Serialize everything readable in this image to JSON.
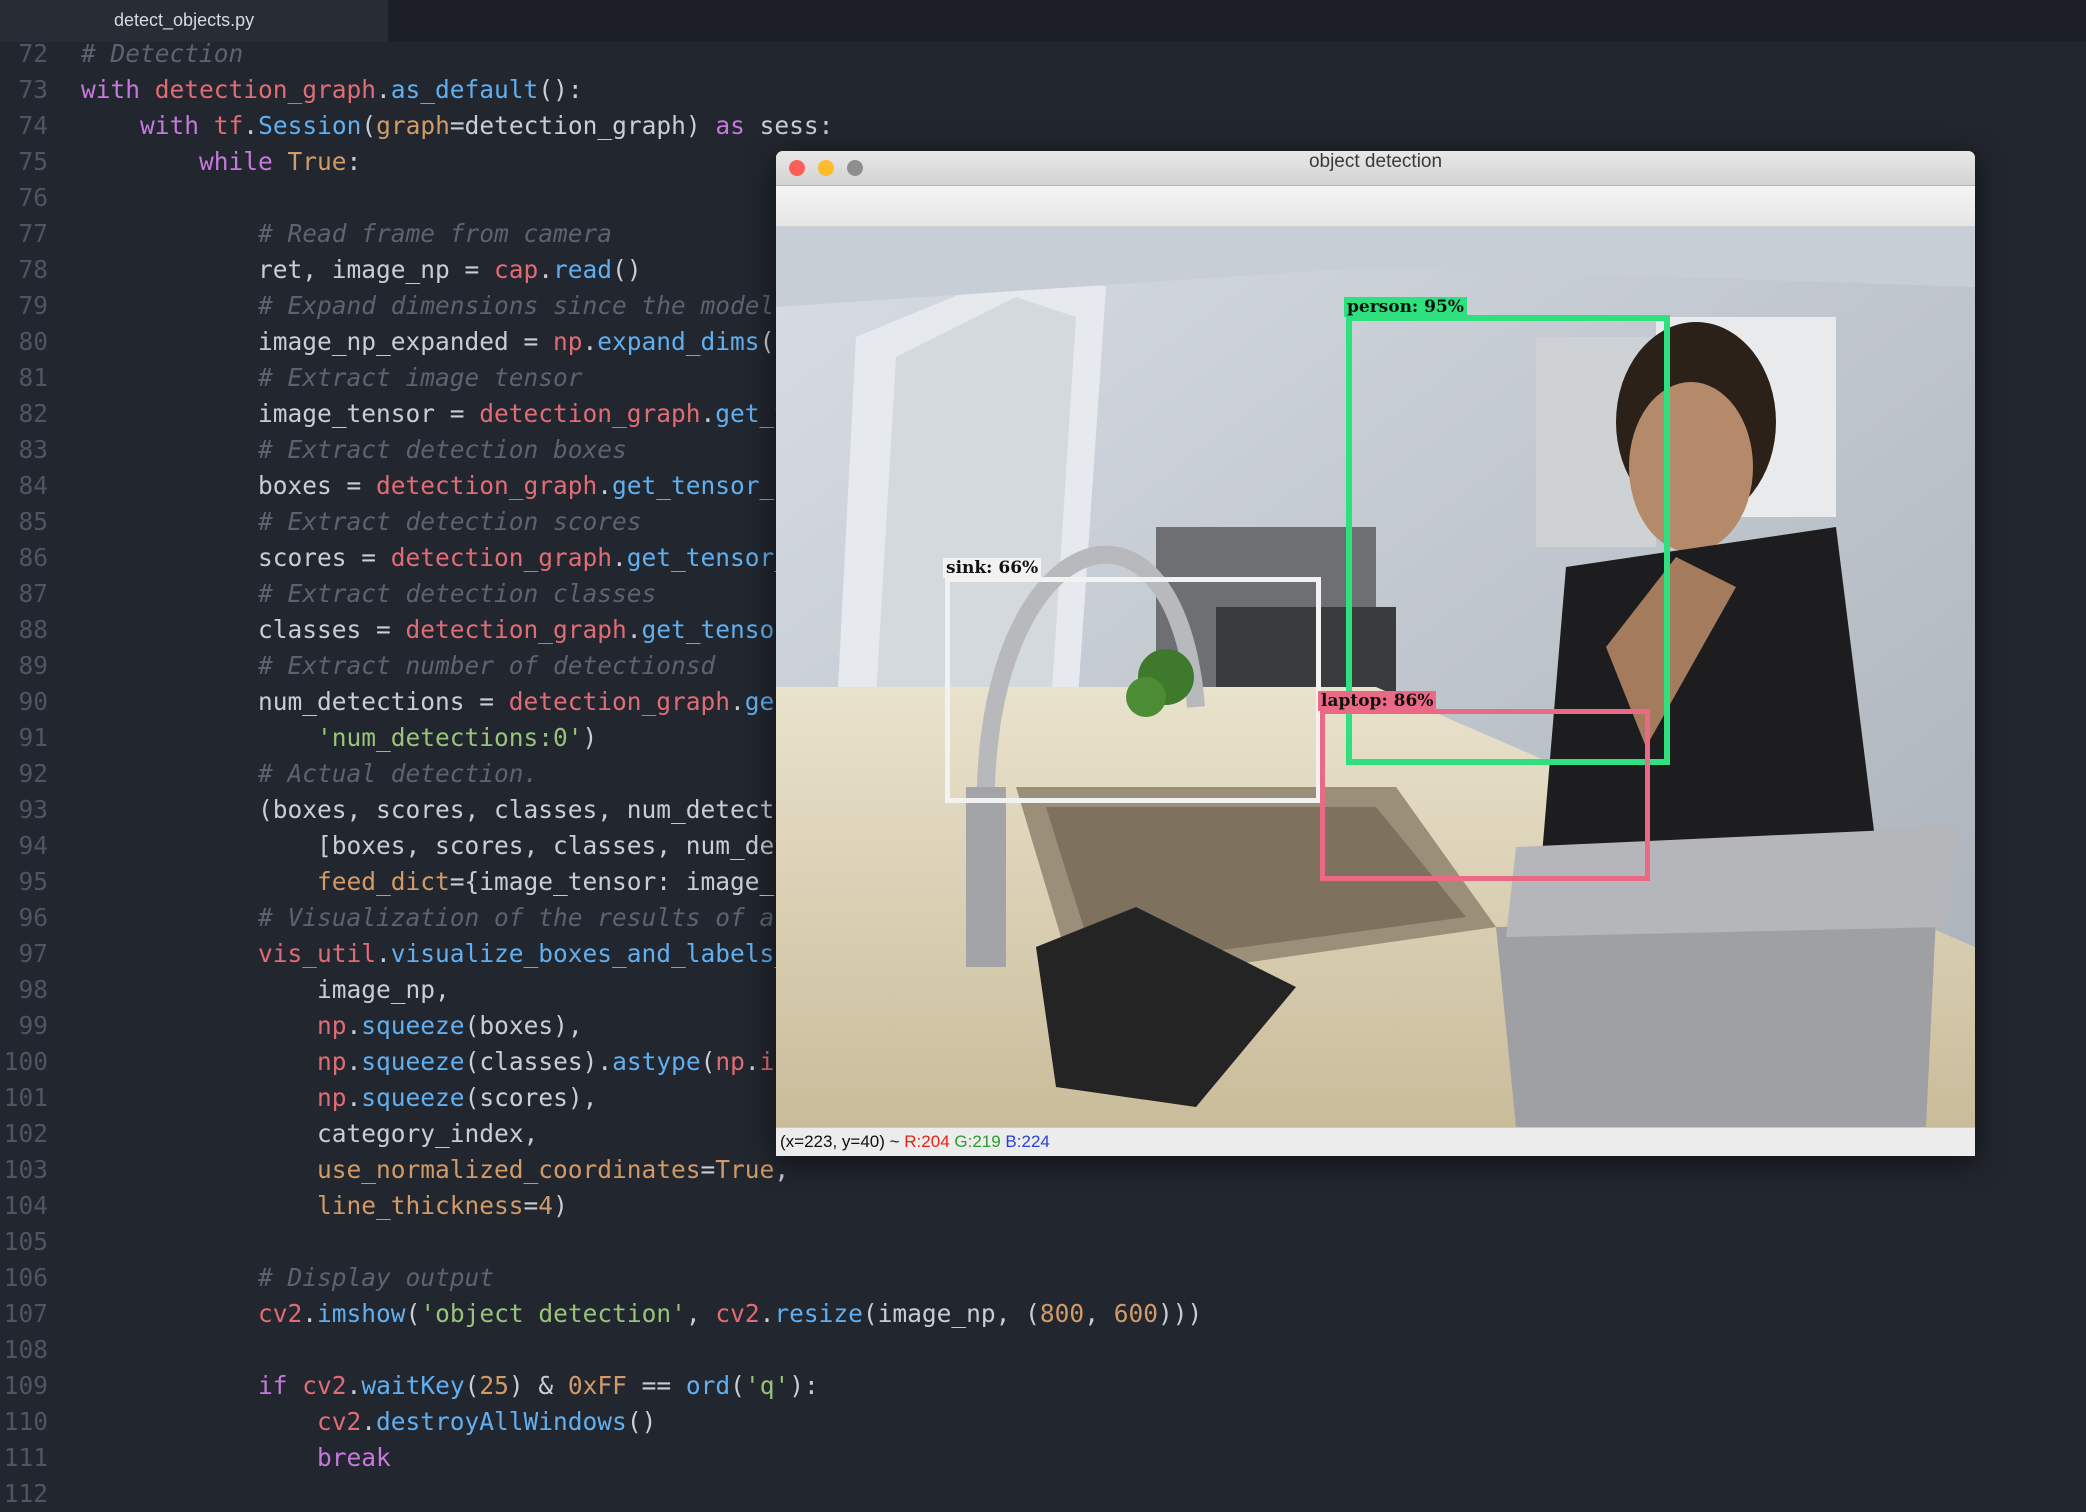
{
  "editor": {
    "tab_label": "detect_objects.py",
    "lines": [
      {
        "n": "72",
        "t": [
          [
            "cm",
            "# Detection"
          ]
        ]
      },
      {
        "n": "73",
        "t": [
          [
            "kw",
            "with "
          ],
          [
            "var",
            "detection_graph"
          ],
          [
            "p",
            "."
          ],
          [
            "fn",
            "as_default"
          ],
          [
            "p",
            "():"
          ]
        ]
      },
      {
        "n": "74",
        "t": [
          [
            "p",
            "    "
          ],
          [
            "kw",
            "with "
          ],
          [
            "var",
            "tf"
          ],
          [
            "p",
            "."
          ],
          [
            "fn",
            "Session"
          ],
          [
            "p",
            "("
          ],
          [
            "prm",
            "graph"
          ],
          [
            "p",
            "=detection_graph) "
          ],
          [
            "kw",
            "as"
          ],
          [
            "p",
            " sess:"
          ]
        ]
      },
      {
        "n": "75",
        "t": [
          [
            "p",
            "        "
          ],
          [
            "kw",
            "while "
          ],
          [
            "num",
            "True"
          ],
          [
            "p",
            ":"
          ]
        ]
      },
      {
        "n": "76",
        "t": []
      },
      {
        "n": "77",
        "t": [
          [
            "p",
            "            "
          ],
          [
            "cm",
            "# Read frame from camera"
          ]
        ]
      },
      {
        "n": "78",
        "t": [
          [
            "p",
            "            ret, image_np = "
          ],
          [
            "var",
            "cap"
          ],
          [
            "p",
            "."
          ],
          [
            "fn",
            "read"
          ],
          [
            "p",
            "()"
          ]
        ]
      },
      {
        "n": "79",
        "t": [
          [
            "p",
            "            "
          ],
          [
            "cm",
            "# Expand dimensions since the model"
          ]
        ]
      },
      {
        "n": "80",
        "t": [
          [
            "p",
            "            image_np_expanded = "
          ],
          [
            "var",
            "np"
          ],
          [
            "p",
            "."
          ],
          [
            "fn",
            "expand_dims"
          ],
          [
            "p",
            "(i"
          ]
        ]
      },
      {
        "n": "81",
        "t": [
          [
            "p",
            "            "
          ],
          [
            "cm",
            "# Extract image tensor"
          ]
        ]
      },
      {
        "n": "82",
        "t": [
          [
            "p",
            "            image_tensor = "
          ],
          [
            "var",
            "detection_graph"
          ],
          [
            "p",
            "."
          ],
          [
            "fn",
            "get_t"
          ]
        ]
      },
      {
        "n": "83",
        "t": [
          [
            "p",
            "            "
          ],
          [
            "cm",
            "# Extract detection boxes"
          ]
        ]
      },
      {
        "n": "84",
        "t": [
          [
            "p",
            "            boxes = "
          ],
          [
            "var",
            "detection_graph"
          ],
          [
            "p",
            "."
          ],
          [
            "fn",
            "get_tensor_b"
          ]
        ]
      },
      {
        "n": "85",
        "t": [
          [
            "p",
            "            "
          ],
          [
            "cm",
            "# Extract detection scores"
          ]
        ]
      },
      {
        "n": "86",
        "t": [
          [
            "p",
            "            scores = "
          ],
          [
            "var",
            "detection_graph"
          ],
          [
            "p",
            "."
          ],
          [
            "fn",
            "get_tensor_"
          ]
        ]
      },
      {
        "n": "87",
        "t": [
          [
            "p",
            "            "
          ],
          [
            "cm",
            "# Extract detection classes"
          ]
        ]
      },
      {
        "n": "88",
        "t": [
          [
            "p",
            "            classes = "
          ],
          [
            "var",
            "detection_graph"
          ],
          [
            "p",
            "."
          ],
          [
            "fn",
            "get_tensor"
          ]
        ]
      },
      {
        "n": "89",
        "t": [
          [
            "p",
            "            "
          ],
          [
            "cm",
            "# Extract number of detectionsd"
          ]
        ]
      },
      {
        "n": "90",
        "t": [
          [
            "p",
            "            num_detections = "
          ],
          [
            "var",
            "detection_graph"
          ],
          [
            "p",
            "."
          ],
          [
            "fn",
            "get"
          ]
        ]
      },
      {
        "n": "91",
        "t": [
          [
            "p",
            "                "
          ],
          [
            "str",
            "'num_detections:0'"
          ],
          [
            "p",
            ")"
          ]
        ]
      },
      {
        "n": "92",
        "t": [
          [
            "p",
            "            "
          ],
          [
            "cm",
            "# Actual detection."
          ]
        ]
      },
      {
        "n": "93",
        "t": [
          [
            "p",
            "            (boxes, scores, classes, num_detecti"
          ]
        ]
      },
      {
        "n": "94",
        "t": [
          [
            "p",
            "                [boxes, scores, classes, num_det"
          ]
        ]
      },
      {
        "n": "95",
        "t": [
          [
            "p",
            "                "
          ],
          [
            "prm",
            "feed_dict"
          ],
          [
            "p",
            "={image_tensor: image_n"
          ]
        ]
      },
      {
        "n": "96",
        "t": [
          [
            "p",
            "            "
          ],
          [
            "cm",
            "# Visualization of the results of a"
          ]
        ]
      },
      {
        "n": "97",
        "t": [
          [
            "p",
            "            "
          ],
          [
            "var",
            "vis_util"
          ],
          [
            "p",
            "."
          ],
          [
            "fn",
            "visualize_boxes_and_labels_"
          ]
        ]
      },
      {
        "n": "98",
        "t": [
          [
            "p",
            "                image_np,"
          ]
        ]
      },
      {
        "n": "99",
        "t": [
          [
            "p",
            "                "
          ],
          [
            "var",
            "np"
          ],
          [
            "p",
            "."
          ],
          [
            "fn",
            "squeeze"
          ],
          [
            "p",
            "(boxes),"
          ]
        ]
      },
      {
        "n": "100",
        "t": [
          [
            "p",
            "                "
          ],
          [
            "var",
            "np"
          ],
          [
            "p",
            "."
          ],
          [
            "fn",
            "squeeze"
          ],
          [
            "p",
            "(classes)."
          ],
          [
            "fn",
            "astype"
          ],
          [
            "p",
            "("
          ],
          [
            "var",
            "np"
          ],
          [
            "p",
            "."
          ],
          [
            "var",
            "in"
          ]
        ]
      },
      {
        "n": "101",
        "t": [
          [
            "p",
            "                "
          ],
          [
            "var",
            "np"
          ],
          [
            "p",
            "."
          ],
          [
            "fn",
            "squeeze"
          ],
          [
            "p",
            "(scores),"
          ]
        ]
      },
      {
        "n": "102",
        "t": [
          [
            "p",
            "                category_index,"
          ]
        ]
      },
      {
        "n": "103",
        "t": [
          [
            "p",
            "                "
          ],
          [
            "prm",
            "use_normalized_coordinates"
          ],
          [
            "p",
            "="
          ],
          [
            "num",
            "True"
          ],
          [
            "p",
            ","
          ]
        ]
      },
      {
        "n": "104",
        "t": [
          [
            "p",
            "                "
          ],
          [
            "prm",
            "line_thickness"
          ],
          [
            "p",
            "="
          ],
          [
            "num",
            "4"
          ],
          [
            "p",
            ")"
          ]
        ]
      },
      {
        "n": "105",
        "t": []
      },
      {
        "n": "106",
        "t": [
          [
            "p",
            "            "
          ],
          [
            "cm",
            "# Display output"
          ]
        ]
      },
      {
        "n": "107",
        "t": [
          [
            "p",
            "            "
          ],
          [
            "var",
            "cv2"
          ],
          [
            "p",
            "."
          ],
          [
            "fn",
            "imshow"
          ],
          [
            "p",
            "("
          ],
          [
            "str",
            "'object detection'"
          ],
          [
            "p",
            ", "
          ],
          [
            "var",
            "cv2"
          ],
          [
            "p",
            "."
          ],
          [
            "fn",
            "resize"
          ],
          [
            "p",
            "(image_np, ("
          ],
          [
            "num",
            "800"
          ],
          [
            "p",
            ", "
          ],
          [
            "num",
            "600"
          ],
          [
            "p",
            ")))"
          ]
        ]
      },
      {
        "n": "108",
        "t": []
      },
      {
        "n": "109",
        "t": [
          [
            "p",
            "            "
          ],
          [
            "kw",
            "if "
          ],
          [
            "var",
            "cv2"
          ],
          [
            "p",
            "."
          ],
          [
            "fn",
            "waitKey"
          ],
          [
            "p",
            "("
          ],
          [
            "num",
            "25"
          ],
          [
            "p",
            ") & "
          ],
          [
            "num",
            "0xFF"
          ],
          [
            "p",
            " == "
          ],
          [
            "fn",
            "ord"
          ],
          [
            "p",
            "("
          ],
          [
            "str",
            "'q'"
          ],
          [
            "p",
            "):"
          ]
        ]
      },
      {
        "n": "110",
        "t": [
          [
            "p",
            "                "
          ],
          [
            "var",
            "cv2"
          ],
          [
            "p",
            "."
          ],
          [
            "fn",
            "destroyAllWindows"
          ],
          [
            "p",
            "()"
          ]
        ]
      },
      {
        "n": "111",
        "t": [
          [
            "p",
            "                "
          ],
          [
            "kw",
            "break"
          ]
        ]
      },
      {
        "n": "112",
        "t": []
      }
    ]
  },
  "window": {
    "title": "object detection",
    "status": {
      "coords": "(x=223, y=40) ~ ",
      "r": "R:204",
      "g": " G:219",
      "b": " B:224"
    },
    "detections": [
      {
        "label": "person:  95%",
        "color": "#2fe07e"
      },
      {
        "label": "sink:  66%",
        "color": "#f2f2f2"
      },
      {
        "label": "laptop:  86%",
        "color": "#ea6a85"
      }
    ]
  },
  "colors": {
    "close": "#fc5f57",
    "minimize": "#fdbc2e",
    "zoom": "#8e8e8e"
  }
}
